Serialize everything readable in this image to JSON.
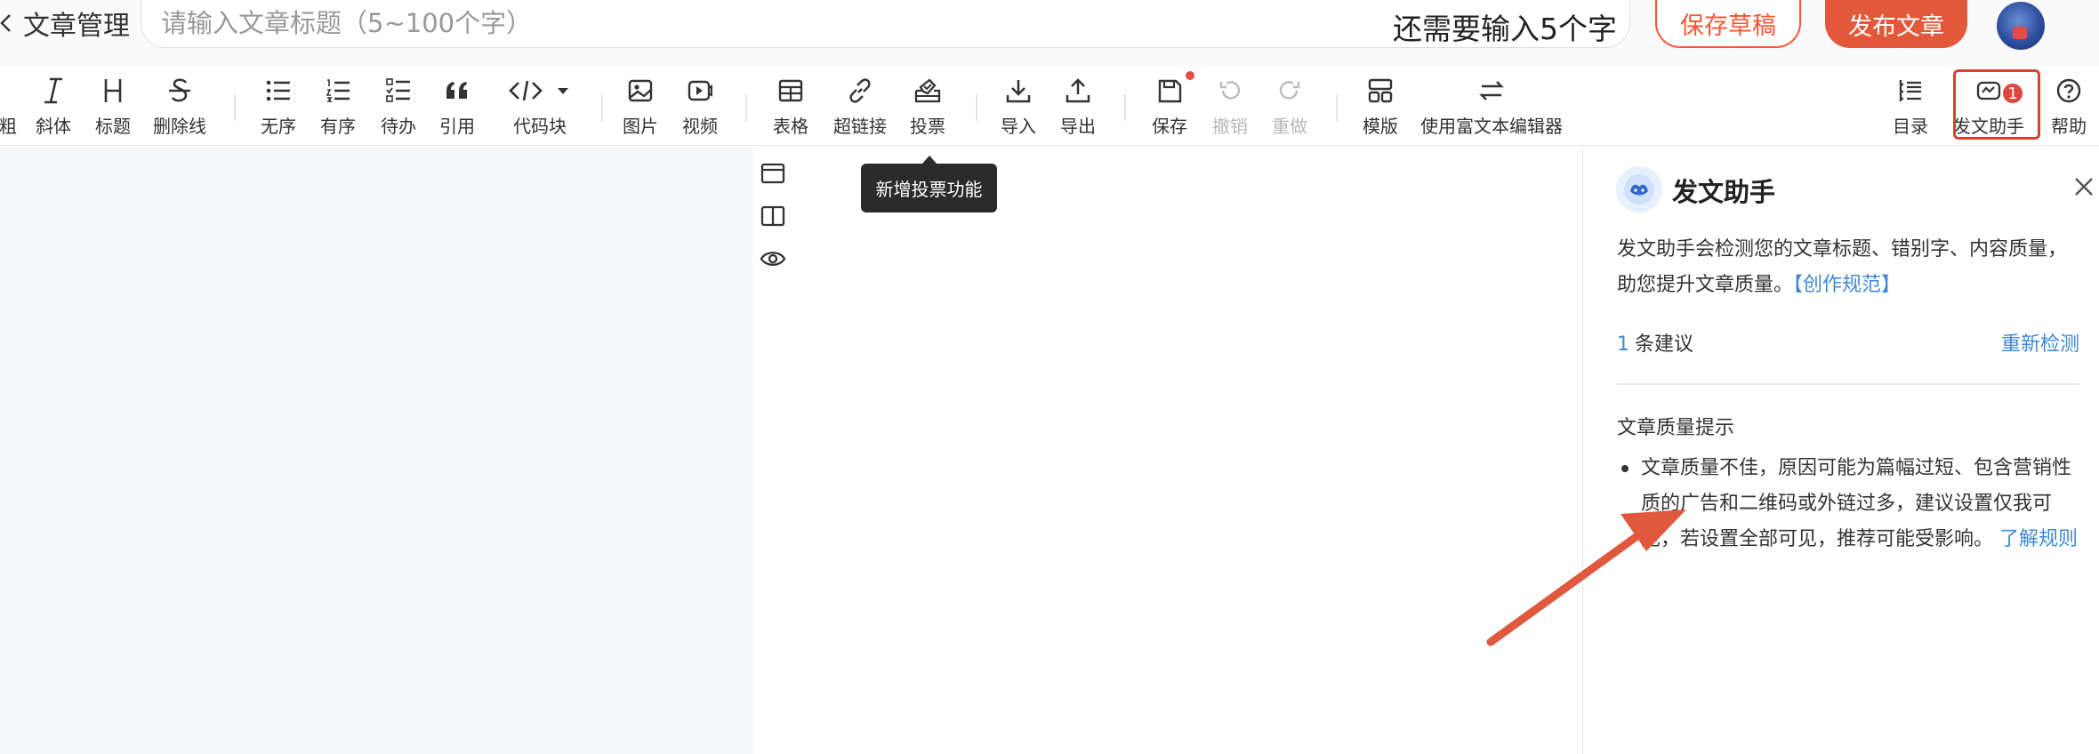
{
  "header": {
    "back_label": "文章管理",
    "title_placeholder": "请输入文章标题（5~100个字）",
    "title_value": "",
    "title_counter": "还需要输入5个字",
    "save_draft_label": "保存草稿",
    "publish_label": "发布文章"
  },
  "toolbar": {
    "items": [
      {
        "label": "粗",
        "icon": "bold-icon"
      },
      {
        "label": "斜体",
        "icon": "italic-icon"
      },
      {
        "label": "标题",
        "icon": "heading-icon"
      },
      {
        "label": "删除线",
        "icon": "strikethrough-icon"
      },
      {
        "label": "无序",
        "icon": "unordered-list-icon"
      },
      {
        "label": "有序",
        "icon": "ordered-list-icon"
      },
      {
        "label": "待办",
        "icon": "todo-list-icon"
      },
      {
        "label": "引用",
        "icon": "quote-icon"
      },
      {
        "label": "代码块",
        "icon": "code-block-icon"
      },
      {
        "label": "图片",
        "icon": "image-icon"
      },
      {
        "label": "视频",
        "icon": "video-icon"
      },
      {
        "label": "表格",
        "icon": "table-icon"
      },
      {
        "label": "超链接",
        "icon": "link-icon"
      },
      {
        "label": "投票",
        "icon": "vote-icon"
      },
      {
        "label": "导入",
        "icon": "import-icon"
      },
      {
        "label": "导出",
        "icon": "export-icon"
      },
      {
        "label": "保存",
        "icon": "save-icon"
      },
      {
        "label": "撤销",
        "icon": "undo-icon"
      },
      {
        "label": "重做",
        "icon": "redo-icon"
      },
      {
        "label": "模版",
        "icon": "template-icon"
      },
      {
        "label": "使用富文本编辑器",
        "icon": "switch-editor-icon"
      },
      {
        "label": "目录",
        "icon": "toc-icon"
      },
      {
        "label": "发文助手",
        "icon": "assistant-icon"
      },
      {
        "label": "帮助",
        "icon": "help-icon"
      }
    ],
    "assistant_badge": "1"
  },
  "tooltip": "新增投票功能",
  "panel": {
    "title": "发文助手",
    "desc": "发文助手会检测您的文章标题、错别字、内容质量，助您提升文章质量。",
    "desc_link": "【创作规范】",
    "suggest_count": "1",
    "suggest_label": "条建议",
    "recheck": "重新检测",
    "quality_title": "文章质量提示",
    "quality_text": "文章质量不佳，原因可能为篇幅过短、包含营销性质的广告和二维码或外链过多，建议设置仅我可见，若设置全部可见，推荐可能受影响。",
    "quality_link": "了解规则"
  },
  "colors": {
    "accent": "#fc5531",
    "link": "#3e88d6",
    "highlight_frame": "#d9412e",
    "arrow": "#e0583d"
  }
}
